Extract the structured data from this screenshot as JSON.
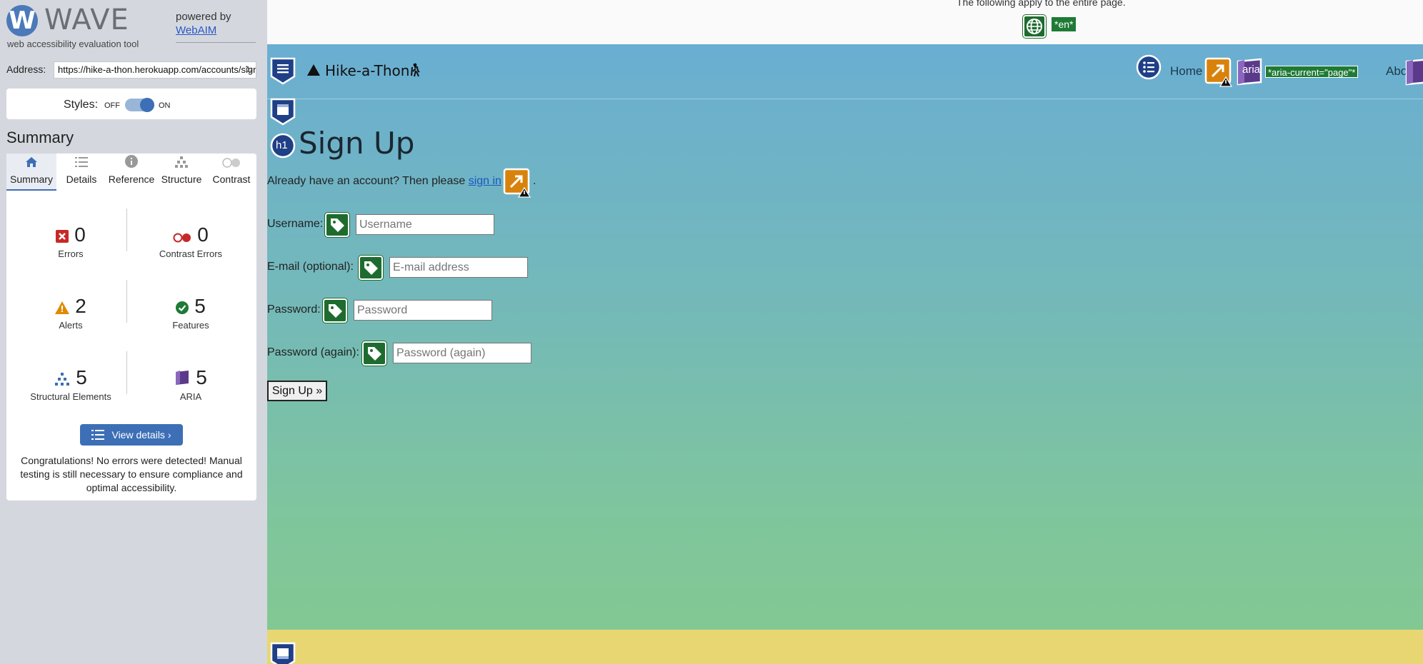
{
  "wave": {
    "logo_text": "WAVE",
    "logo_mark": "W",
    "tagline": "web accessibility evaluation tool",
    "powered_by": "powered by",
    "webaim_link": "WebAIM",
    "address_label": "Address:",
    "address_value": "https://hike-a-thon.herokuapp.com/accounts/signup/",
    "styles_label": "Styles:",
    "styles_off": "OFF",
    "styles_on": "ON",
    "summary_title": "Summary",
    "tabs": [
      {
        "label": "Summary",
        "icon": "home-icon",
        "active": true
      },
      {
        "label": "Details",
        "icon": "list-icon",
        "active": false
      },
      {
        "label": "Reference",
        "icon": "info-icon",
        "active": false
      },
      {
        "label": "Structure",
        "icon": "hierarchy-icon",
        "active": false
      },
      {
        "label": "Contrast",
        "icon": "contrast-icon",
        "active": false
      }
    ],
    "stats": {
      "errors": {
        "count": "0",
        "label": "Errors",
        "color": "#c62828"
      },
      "contrast_errors": {
        "count": "0",
        "label": "Contrast Errors",
        "color": "#c62828"
      },
      "alerts": {
        "count": "2",
        "label": "Alerts",
        "color": "#e08a00"
      },
      "features": {
        "count": "5",
        "label": "Features",
        "color": "#1e7a35"
      },
      "structural": {
        "count": "5",
        "label": "Structural Elements",
        "color": "#3d6fb6"
      },
      "aria": {
        "count": "5",
        "label": "ARIA",
        "color": "#5b3a8c"
      }
    },
    "view_details": "View details ›",
    "congrats": "Congratulations! No errors were detected! Manual testing is still necessary to ensure compliance and optimal accessibility."
  },
  "page": {
    "top_message": "The following apply to the entire page.",
    "lang_tag": "*en*",
    "brand": "Hike-a-Thon",
    "nav_home": "Home",
    "aria_badge": "aria",
    "aria_current": "*aria-current=\"page\"*",
    "nav_about": "About",
    "h1_badge": "h1",
    "title": "Sign Up",
    "already_text": "Already have an account? Then please",
    "sign_in_link": "sign in",
    "period": ".",
    "fields": [
      {
        "label": "Username:",
        "placeholder": "Username"
      },
      {
        "label": "E-mail (optional):",
        "placeholder": "E-mail address"
      },
      {
        "label": "Password:",
        "placeholder": "Password"
      },
      {
        "label": "Password (again):",
        "placeholder": "Password (again)"
      }
    ],
    "submit": "Sign Up »"
  },
  "colors": {
    "wave_blue": "#3d6fb6",
    "feature_green": "#1e6b2f",
    "alert_orange": "#d9820b",
    "aria_purple": "#5b3a8c",
    "structure_navy": "#1f3f86",
    "footer_yellow": "#e8d673"
  }
}
